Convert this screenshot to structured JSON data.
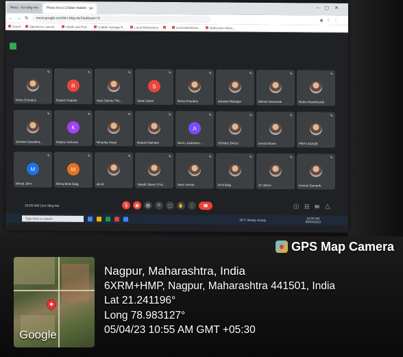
{
  "browser": {
    "tabs": [
      {
        "label": "Meet - kcr-ldrg-rtw",
        "active": false
      },
      {
        "label": "Photo Acco Chidan Nabek - go",
        "active": true
      }
    ],
    "url": "meet.google.com/kcr-ldrg-rtw?authuser=0",
    "bookmarks": [
      "Gmail",
      "Salesforce Lateral...",
      "CBSE and Prof...",
      "Cubbie Settings R...",
      "Local Admissions",
      "",
      "Local Admission...",
      "Admission Mana..."
    ]
  },
  "meet": {
    "participants": [
      {
        "name": "Neha Choubey",
        "initial": "",
        "color": "",
        "photo": true
      },
      {
        "name": "Rajesh Satpute",
        "initial": "R",
        "color": "#e8453c",
        "photo": false
      },
      {
        "name": "Anju Gairola The...",
        "initial": "",
        "color": "",
        "photo": true
      },
      {
        "name": "Swati Jaitan",
        "initial": "S",
        "color": "#e8453c",
        "photo": false
      },
      {
        "name": "Neha Choubey",
        "initial": "",
        "color": "",
        "photo": true
      },
      {
        "name": "Ashwini Mahajan",
        "initial": "",
        "color": "",
        "photo": true
      },
      {
        "name": "Mohini Ganvarde",
        "initial": "",
        "color": "",
        "photo": true
      },
      {
        "name": "Rohini Ramkhamb",
        "initial": "",
        "color": "",
        "photo": true
      },
      {
        "name": "Ashwini Sawakha...",
        "initial": "",
        "color": "",
        "photo": true
      },
      {
        "name": "Kalpna Saharan",
        "initial": "K",
        "color": "#a142f4",
        "photo": false
      },
      {
        "name": "Niharika Singh",
        "initial": "",
        "color": "",
        "photo": true
      },
      {
        "name": "Rajesh Rathiote",
        "initial": "",
        "color": "",
        "photo": true
      },
      {
        "name": "Aarzu Jasbrame...",
        "initial": "A",
        "color": "#7c4dff",
        "photo": false
      },
      {
        "name": "SONALI BASU",
        "initial": "",
        "color": "",
        "photo": true
      },
      {
        "name": "Ismail Shoen",
        "initial": "",
        "color": "",
        "photo": true
      },
      {
        "name": "PRITI KAKDE",
        "initial": "",
        "color": "",
        "photo": true
      },
      {
        "name": "Mirnal John",
        "initial": "M",
        "color": "#1a73e8",
        "photo": false
      },
      {
        "name": "Mirna Mole Baig",
        "initial": "M",
        "color": "#e8711c",
        "photo": false
      },
      {
        "name": "ab kk",
        "initial": "",
        "color": "",
        "photo": true
      },
      {
        "name": "Yasadi Sheen (Yra...",
        "initial": "",
        "color": "",
        "photo": true
      },
      {
        "name": "Sarvi Verma",
        "initial": "",
        "color": "",
        "photo": true
      },
      {
        "name": "M M Balg",
        "initial": "",
        "color": "",
        "photo": true
      },
      {
        "name": "37 others",
        "initial": "",
        "color": "",
        "photo": true
      },
      {
        "name": "Umesh Samarth",
        "initial": "",
        "color": "",
        "photo": true
      }
    ],
    "footer_time": "10:55 AM  |  kcr-ldrg-rtw"
  },
  "taskbar": {
    "search_placeholder": "Type here to search",
    "weather": "29°C  Mostly cloudy",
    "tray_time": "10:55 AM",
    "tray_date": "05/04/2023"
  },
  "gps": {
    "title": "GPS Map Camera",
    "city": "Nagpur, Maharashtra, India",
    "address": "6XRM+HMP, Nagpur, Maharashtra 441501, India",
    "lat": "Lat 21.241196°",
    "long": "Long 78.983127°",
    "datetime": "05/04/23 10:55 AM GMT +05:30",
    "map_logo": "Google"
  }
}
